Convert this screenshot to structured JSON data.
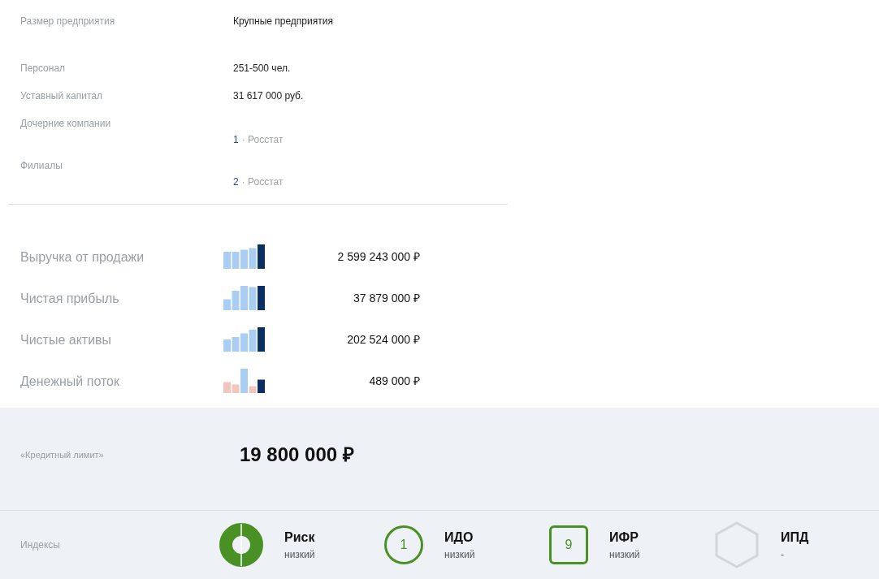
{
  "info_rows": [
    {
      "label": "Размер предприятия",
      "value": "Крупные предприятия"
    },
    {
      "label": "Персонал",
      "value": "251-500 чел."
    },
    {
      "label": "Уставный капитал",
      "value": "31 617 000 руб."
    },
    {
      "label": "Дочерние компании",
      "count": "1",
      "source": "· Росстат"
    },
    {
      "label": "Филиалы",
      "count": "2",
      "source": "· Росстат"
    }
  ],
  "finance_rows": [
    {
      "label": "Выручка от продажи",
      "amount": "2 599 243 000 ₽"
    },
    {
      "label": "Чистая прибыль",
      "amount": "37 879 000 ₽"
    },
    {
      "label": "Чистые активы",
      "amount": "202 524 000 ₽"
    },
    {
      "label": "Денежный поток",
      "amount": "489 000 ₽"
    }
  ],
  "credit_limit": {
    "label": "«Кредитный лимит»",
    "amount": "19 800 000 ₽"
  },
  "indices": {
    "label": "Индексы",
    "items": [
      {
        "kind": "donut",
        "name": "Риск",
        "level_text": "низкий"
      },
      {
        "kind": "circle",
        "badge": "1",
        "name": "ИДО",
        "level_text": "низкий"
      },
      {
        "kind": "square",
        "badge": "9",
        "name": "ИФР",
        "level_text": "низкий"
      },
      {
        "kind": "hexagon",
        "name": "ИПД",
        "level_text": "-"
      }
    ]
  }
}
